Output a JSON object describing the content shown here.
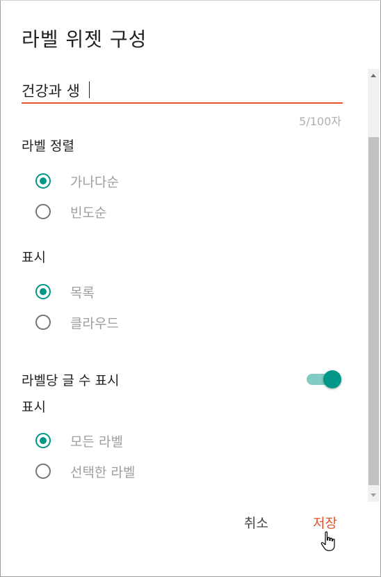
{
  "dialog": {
    "title": "라벨 위젯 구성",
    "title_input": {
      "value": "건강과 생",
      "counter": "5/100자"
    },
    "sort": {
      "label": "라벨 정렬",
      "options": [
        {
          "label": "가나다순",
          "checked": true
        },
        {
          "label": "빈도순",
          "checked": false
        }
      ]
    },
    "display": {
      "label": "표시",
      "options": [
        {
          "label": "목록",
          "checked": true
        },
        {
          "label": "클라우드",
          "checked": false
        }
      ]
    },
    "show_count": {
      "label": "라벨당 글 수 표시",
      "on": true
    },
    "show": {
      "label": "표시",
      "options": [
        {
          "label": "모든 라벨",
          "checked": true
        },
        {
          "label": "선택한 라벨",
          "checked": false
        }
      ]
    },
    "buttons": {
      "cancel": "취소",
      "save": "저장"
    }
  },
  "colors": {
    "accent": "#e6522c",
    "teal": "#009688",
    "teal_light": "#80cbc4"
  }
}
